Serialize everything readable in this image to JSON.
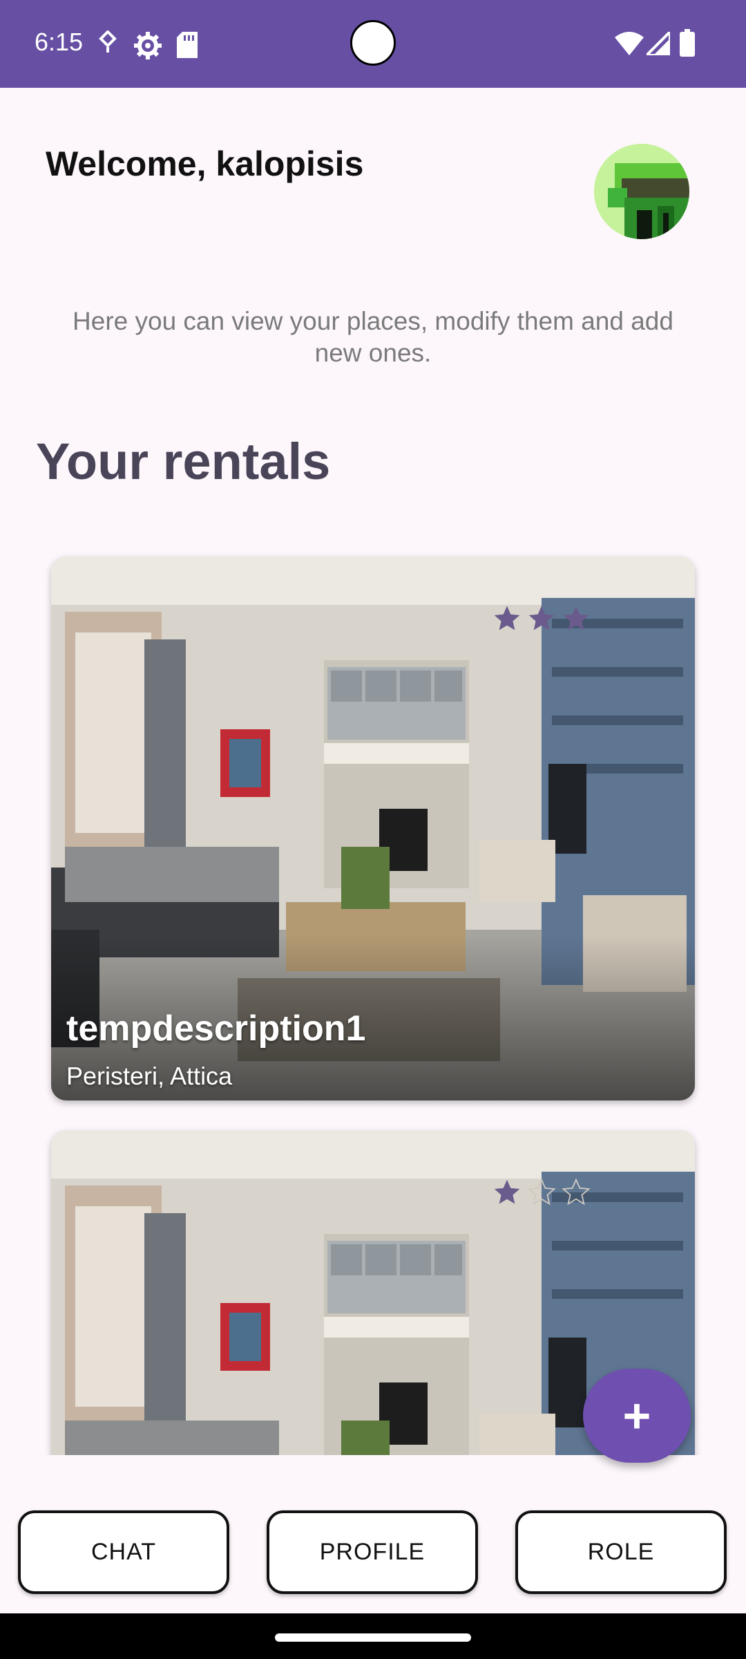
{
  "status_bar": {
    "time": "6:15",
    "icons": [
      "data-saver-icon",
      "settings-icon",
      "sd-card-icon",
      "wifi-icon",
      "signal-icon",
      "battery-icon"
    ],
    "color": "#6750a4"
  },
  "header": {
    "welcome": "Welcome, kalopisis",
    "subtitle": "Here you can view your places, modify them and add new ones."
  },
  "section": {
    "title": "Your rentals"
  },
  "rentals": [
    {
      "title": "tempdescription1",
      "location": "Peristeri, Attica",
      "rating": 3,
      "max_rating": 3
    },
    {
      "title": "",
      "location": "",
      "rating": 1,
      "max_rating": 3
    }
  ],
  "fab": {
    "label": "+",
    "icon": "add-icon",
    "color": "#6f4fb0"
  },
  "bottom_nav": {
    "chat": "CHAT",
    "profile": "PROFILE",
    "role": "ROLE"
  }
}
